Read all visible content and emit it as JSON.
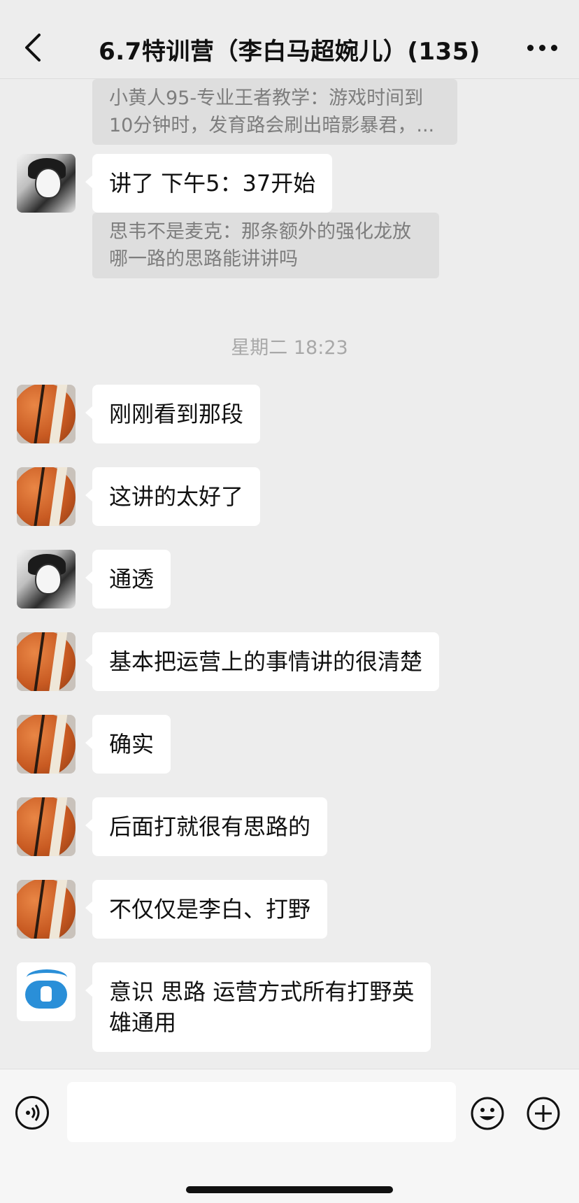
{
  "header": {
    "title": "6.7特训营（李白马超婉儿）(135)",
    "back_icon": "chevron-left-icon",
    "more_icon": "more-dots-icon"
  },
  "quote1": {
    "line1": "小黄人95-专业王者教学：游戏时间到",
    "line2": "10分钟时，发育路会刷出暗影暴君，..."
  },
  "messages": [
    {
      "avatar": "anime-avatar",
      "text": "讲了 下午5：37开始"
    },
    {
      "avatar": "basketball-avatar",
      "text": "刚刚看到那段"
    },
    {
      "avatar": "basketball-avatar",
      "text": "这讲的太好了"
    },
    {
      "avatar": "anime-avatar",
      "text": "通透"
    },
    {
      "avatar": "basketball-avatar",
      "text": "基本把运营上的事情讲的很清楚"
    },
    {
      "avatar": "basketball-avatar",
      "text": "确实"
    },
    {
      "avatar": "basketball-avatar",
      "text": "后面打就很有思路的"
    },
    {
      "avatar": "basketball-avatar",
      "text": "不仅仅是李白、打野"
    },
    {
      "avatar": "logo-avatar",
      "line1": "意识 思路 运营方式所有打野英",
      "line2": "雄通用"
    }
  ],
  "quote2": {
    "line1": "思韦不是麦克：那条额外的强化龙放",
    "line2": "哪一路的思路能讲讲吗"
  },
  "timestamp": "星期二 18:23",
  "input_bar": {
    "voice_icon": "voice-icon",
    "emoji_icon": "emoji-icon",
    "plus_icon": "plus-icon"
  },
  "colors": {
    "background": "#ededed",
    "bubble": "#ffffff",
    "quote_bg": "#dedede",
    "quote_text": "#7d7d7d"
  }
}
